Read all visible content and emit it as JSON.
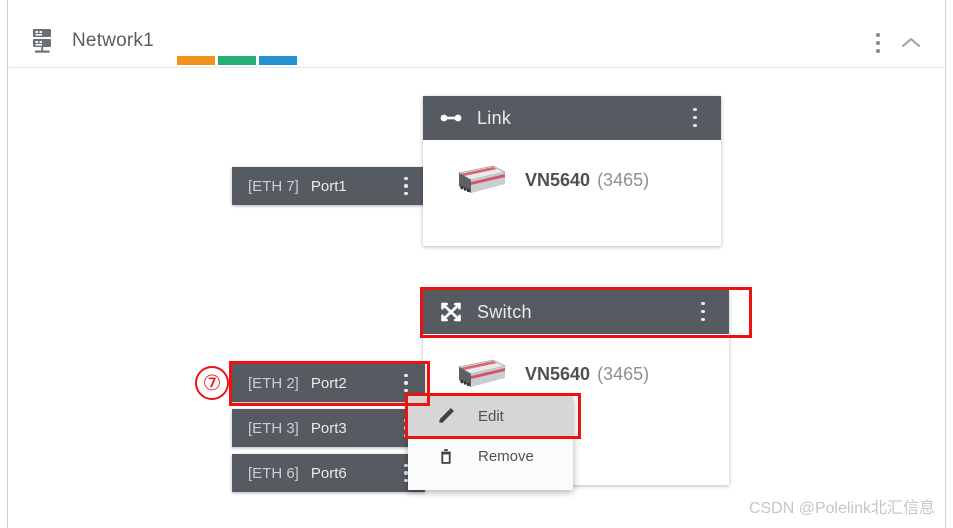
{
  "window": {
    "header": {
      "icon": "network-server-icon",
      "title": "Network1",
      "kebab_icon": "more-vertical-icon",
      "collapse_icon": "chevron-up-icon",
      "status_bars": [
        {
          "name": "bar-orange",
          "color": "#f0941f"
        },
        {
          "name": "bar-green",
          "color": "#27ae72"
        },
        {
          "name": "bar-blue",
          "color": "#2492cf"
        }
      ]
    },
    "watermark": "CSDN @Polelink北汇信息"
  },
  "panels": [
    {
      "id": "link",
      "icon": "link-icon",
      "title": "Link",
      "kebab_icon": "more-vertical-icon",
      "device": {
        "icon": "vn5640-device-icon",
        "name": "VN5640",
        "id": "(3465)"
      }
    },
    {
      "id": "switch",
      "icon": "shuffle-switch-icon",
      "title": "Switch",
      "kebab_icon": "more-vertical-icon",
      "device": {
        "icon": "vn5640-device-icon",
        "name": "VN5640",
        "id": "(3465)"
      }
    }
  ],
  "ports": [
    {
      "id": "port1",
      "eth": "[ETH 7]",
      "name": "Port1",
      "kebab_icon": "more-vertical-icon"
    },
    {
      "id": "port2",
      "eth": "[ETH 2]",
      "name": "Port2",
      "kebab_icon": "more-vertical-icon"
    },
    {
      "id": "port3",
      "eth": "[ETH 3]",
      "name": "Port3",
      "kebab_icon": "more-vertical-icon"
    },
    {
      "id": "port6",
      "eth": "[ETH 6]",
      "name": "Port6",
      "kebab_icon": "more-vertical-icon"
    }
  ],
  "context_menu": {
    "items": [
      {
        "id": "edit",
        "icon": "pencil-icon",
        "label": "Edit",
        "selected": true
      },
      {
        "id": "remove",
        "icon": "trash-icon",
        "label": "Remove",
        "selected": false
      }
    ]
  },
  "annotations": {
    "step_number": "⑦",
    "highlight_color": "#ee1111"
  }
}
